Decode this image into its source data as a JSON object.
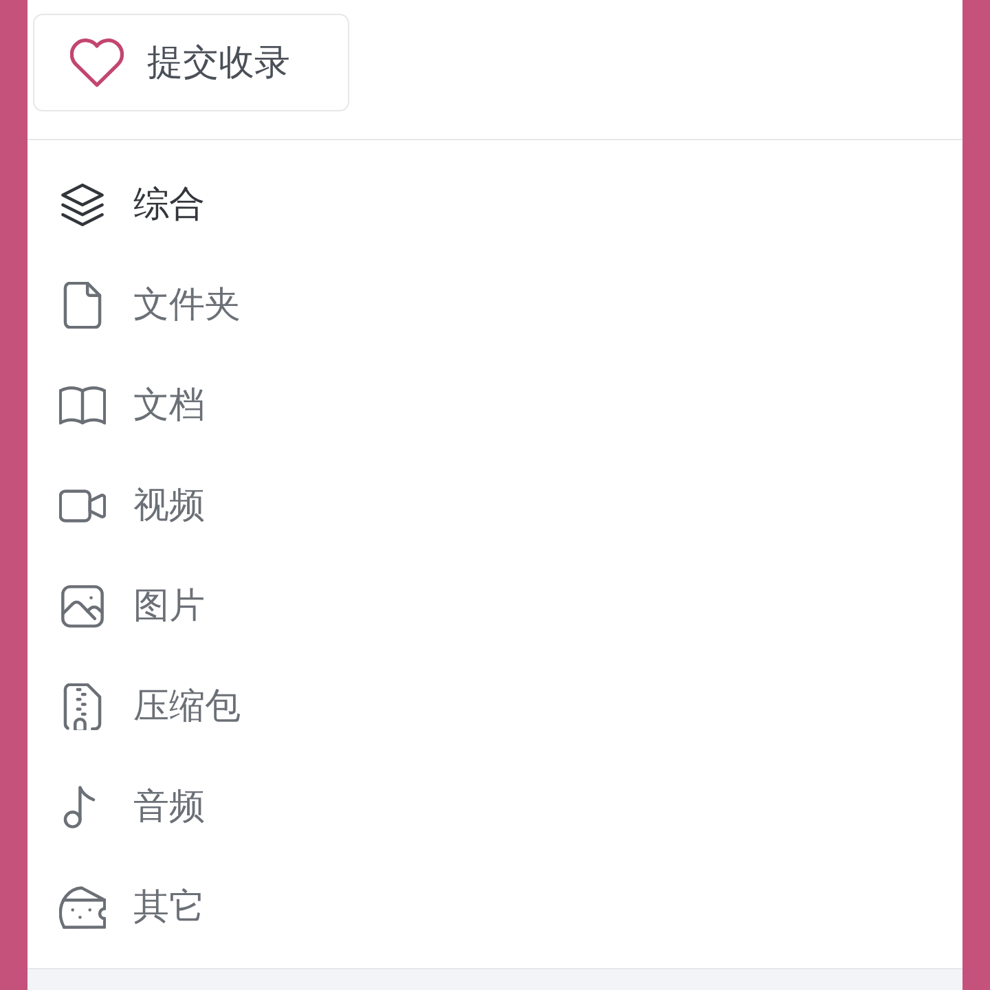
{
  "submit_button": {
    "label": "提交收录"
  },
  "categories": [
    {
      "label": "综合",
      "selected": true
    },
    {
      "label": "文件夹",
      "selected": false
    },
    {
      "label": "文档",
      "selected": false
    },
    {
      "label": "视频",
      "selected": false
    },
    {
      "label": "图片",
      "selected": false
    },
    {
      "label": "压缩包",
      "selected": false
    },
    {
      "label": "音频",
      "selected": false
    },
    {
      "label": "其它",
      "selected": false
    }
  ]
}
